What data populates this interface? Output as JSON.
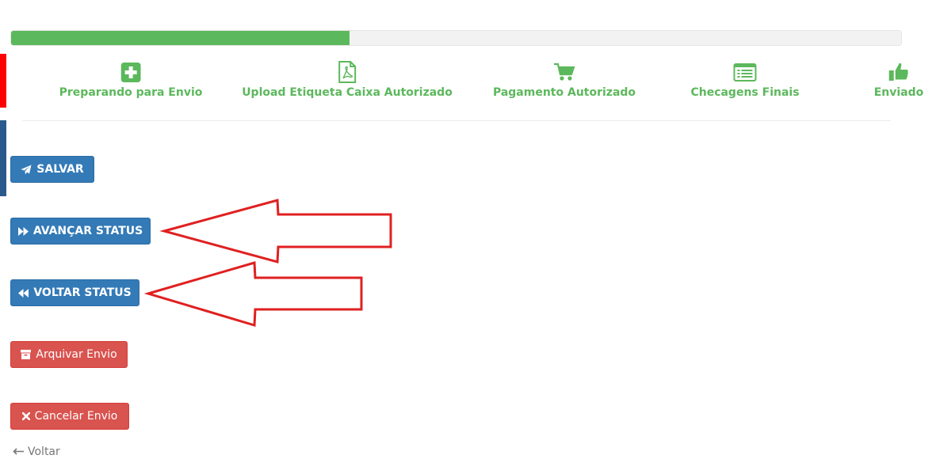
{
  "progress": {
    "fraction": 0.38,
    "fill_color": "#5cb85c"
  },
  "steps": [
    {
      "label": "Preparando para Envio",
      "icon": "plus-square-icon"
    },
    {
      "label": "Upload Etiqueta Caixa Autorizado",
      "icon": "pdf-file-icon"
    },
    {
      "label": "Pagamento Autorizado",
      "icon": "shopping-cart-icon"
    },
    {
      "label": "Checagens Finais",
      "icon": "list-alt-icon"
    },
    {
      "label": "Enviado",
      "icon": "thumbs-up-icon"
    }
  ],
  "actions": {
    "save_label": "SALVAR",
    "advance_label": "AVANÇAR STATUS",
    "back_status_label": "VOLTAR STATUS",
    "archive_label": "Arquivar Envio",
    "cancel_label": "Cancelar Envio"
  },
  "back_link": {
    "label": "Voltar"
  },
  "colors": {
    "primary": "#337ab7",
    "danger": "#d9534f",
    "success": "#5cb85c",
    "annotation": "#e02020"
  }
}
